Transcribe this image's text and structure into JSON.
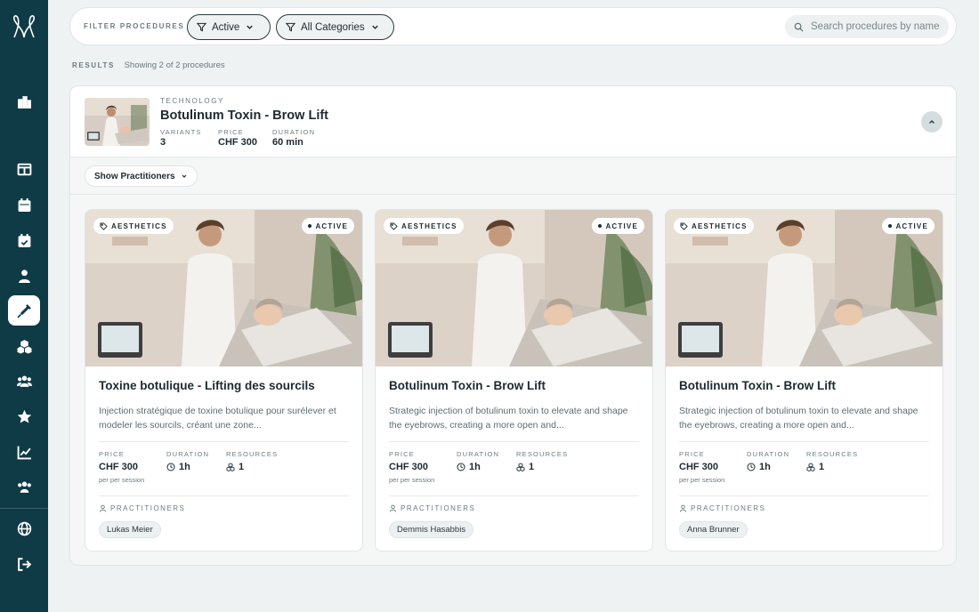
{
  "sidebar": {
    "items": [
      {
        "icon": "buildings-icon",
        "active": false
      },
      {
        "icon": "layout-icon",
        "active": false
      },
      {
        "icon": "calendar-icon",
        "active": false
      },
      {
        "icon": "calendar-check-icon",
        "active": false
      },
      {
        "icon": "user-tie-icon",
        "active": false
      },
      {
        "icon": "syringe-icon",
        "active": true
      },
      {
        "icon": "cubes-icon",
        "active": false
      },
      {
        "icon": "users-icon",
        "active": false
      },
      {
        "icon": "star-icon",
        "active": false
      },
      {
        "icon": "chart-line-icon",
        "active": false
      },
      {
        "icon": "team-icon",
        "active": false
      }
    ],
    "bottom": [
      {
        "icon": "globe-icon"
      },
      {
        "icon": "logout-icon"
      }
    ]
  },
  "filter": {
    "label": "FILTER PROCEDURES",
    "status_value": "Active",
    "category_value": "All Categories",
    "search_placeholder": "Search procedures by name"
  },
  "results": {
    "label": "RESULTS",
    "summary": "Showing 2 of 2 procedures"
  },
  "procedure": {
    "category": "TECHNOLOGY",
    "title": "Botulinum Toxin - Brow Lift",
    "variants_label": "VARIANTS",
    "variants_value": "3",
    "price_label": "PRICE",
    "price_value": "CHF 300",
    "duration_label": "DURATION",
    "duration_value": "60 min",
    "show_practitioners": "Show Practitioners"
  },
  "cards": [
    {
      "tag": "AESTHETICS",
      "status": "ACTIVE",
      "title": "Toxine botulique - Lifting des sourcils",
      "description": "Injection stratégique de toxine botulique pour surélever et modeler les sourcils, créant une zone...",
      "price_label": "PRICE",
      "price": "CHF 300",
      "price_sub": "per per session",
      "duration_label": "DURATION",
      "duration": "1h",
      "resources_label": "RESOURCES",
      "resources": "1",
      "practitioners_label": "PRACTITIONERS",
      "practitioner": "Lukas Meier"
    },
    {
      "tag": "AESTHETICS",
      "status": "ACTIVE",
      "title": "Botulinum Toxin - Brow Lift",
      "description": "Strategic injection of botulinum toxin to elevate and shape the eyebrows, creating a more open and...",
      "price_label": "PRICE",
      "price": "CHF 300",
      "price_sub": "per per session",
      "duration_label": "DURATION",
      "duration": "1h",
      "resources_label": "RESOURCES",
      "resources": "1",
      "practitioners_label": "PRACTITIONERS",
      "practitioner": "Demmis Hasabbis"
    },
    {
      "tag": "AESTHETICS",
      "status": "ACTIVE",
      "title": "Botulinum Toxin - Brow Lift",
      "description": "Strategic injection of botulinum toxin to elevate and shape the eyebrows, creating a more open and...",
      "price_label": "PRICE",
      "price": "CHF 300",
      "price_sub": "per per session",
      "duration_label": "DURATION",
      "duration": "1h",
      "resources_label": "RESOURCES",
      "resources": "1",
      "practitioners_label": "PRACTITIONERS",
      "practitioner": "Anna Brunner"
    }
  ],
  "colors": {
    "sidebar": "#0f3b47",
    "background": "#eef2f3",
    "text": "#1e2a30"
  }
}
